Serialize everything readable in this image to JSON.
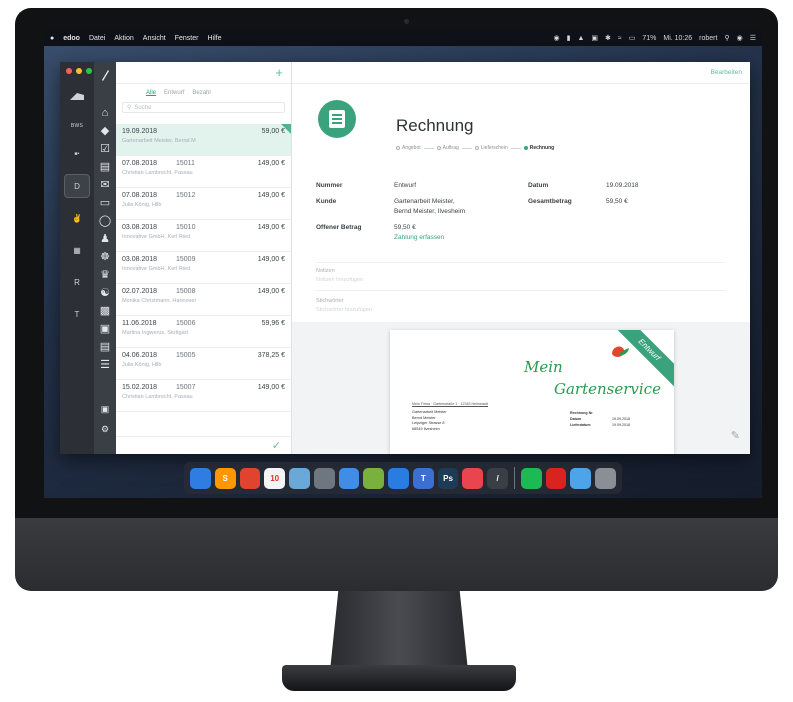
{
  "menubar": {
    "apple": "",
    "app_name": "edoo",
    "items": [
      "Datei",
      "Aktion",
      "Ansicht",
      "Fenster",
      "Hilfe"
    ],
    "clock": "Mi. 10:26",
    "user": "robert",
    "battery": "71%",
    "status_icons": [
      "wifi-icon",
      "bluetooth-icon",
      "battery-icon",
      "search-icon",
      "siri-icon",
      "notification-icon"
    ]
  },
  "workspaces": [
    "",
    "BWS",
    "",
    "D",
    "",
    "",
    "R",
    "T"
  ],
  "nav_icons": [
    "home-icon",
    "tag-icon",
    "check-icon",
    "document-icon",
    "mail-icon",
    "card-icon",
    "ring-icon",
    "person-icon",
    "group-icon",
    "hand-icon",
    "bank-icon",
    "book-icon",
    "chat-icon",
    "table-icon",
    "list-icon",
    "lock-icon",
    "gear-icon"
  ],
  "list": {
    "add": "+",
    "filters": [
      "Alle",
      "Entwurf",
      "Bezahl"
    ],
    "search_placeholder": "Suche",
    "items": [
      {
        "date": "19.09.2018",
        "number": "",
        "amount": "59,00 €",
        "customer": "Gartenarbeit Meister, Bernd M"
      },
      {
        "date": "07.08.2018",
        "number": "15011",
        "amount": "149,00 €",
        "customer": "Christian Lambrecht, Passau"
      },
      {
        "date": "07.08.2018",
        "number": "15012",
        "amount": "149,00 €",
        "customer": "Julia König, Hilb"
      },
      {
        "date": "03.08.2018",
        "number": "15010",
        "amount": "149,00 €",
        "customer": "Innovative GmbH, Kerl Ried"
      },
      {
        "date": "03.08.2018",
        "number": "15009",
        "amount": "149,00 €",
        "customer": "Innovative GmbH, Kerl Ried"
      },
      {
        "date": "02.07.2018",
        "number": "15008",
        "amount": "149,00 €",
        "customer": "Monika Christmann, Hannover"
      },
      {
        "date": "11.06.2018",
        "number": "15006",
        "amount": "59,96 €",
        "customer": "Martina Ingwerus, Stuttgart"
      },
      {
        "date": "04.06.2018",
        "number": "15005",
        "amount": "378,25 €",
        "customer": "Julia König, Hilb"
      },
      {
        "date": "15.02.2018",
        "number": "15007",
        "amount": "149,00 €",
        "customer": "Christian Lambrecht, Passau"
      }
    ]
  },
  "detail": {
    "edit": "Bearbeiten",
    "title": "Rechnung",
    "steps": [
      "Angebot",
      "Auftrag",
      "Lieferschein",
      "Rechnung"
    ],
    "fields": {
      "nummer_label": "Nummer",
      "nummer_value": "Entwurf",
      "datum_label": "Datum",
      "datum_value": "19.09.2018",
      "kunde_label": "Kunde",
      "kunde_value_1": "Gartenarbeit Meister,",
      "kunde_value_2": "Bernd Meister, Ilvesheim",
      "gesamt_label": "Gesamtbetrag",
      "gesamt_value": "59,50 €",
      "offen_label": "Offener Betrag",
      "offen_value": "59,50 €",
      "zahlung_link": "Zahlung erfassen"
    },
    "notes": {
      "label_1": "Notizen",
      "hint_1": "Notizen hinzufügen",
      "label_2": "Stichwörter",
      "hint_2": "Stichwörter hinzufügen"
    }
  },
  "preview": {
    "logo_line1": "Mein",
    "logo_line2": "Gartenservice",
    "banner": "Entwurf",
    "sender": "Mein Firma · Gartenstraße 1 · 12345 Heimstadt",
    "address": [
      "Gartenarbeit Meister",
      "Bernd Meister",
      "Leipziger Strasse 8",
      "68549 Ilvesheim"
    ],
    "meta": [
      {
        "k": "Rechnung Nr.",
        "v": ""
      },
      {
        "k": "Datum",
        "v": "19.09.2018"
      },
      {
        "k": "Lieferdatum",
        "v": "19.09.2018"
      }
    ]
  },
  "dock": {
    "apps": [
      {
        "name": "finder-icon",
        "color": "#2f7de1",
        "glyph": ""
      },
      {
        "name": "sublime-icon",
        "color": "#ff9800",
        "glyph": "S"
      },
      {
        "name": "chrome-icon",
        "color": "#e0442f",
        "glyph": ""
      },
      {
        "name": "calendar-icon",
        "color": "#f4f4f4",
        "glyph": "10"
      },
      {
        "name": "preview-icon",
        "color": "#6aa8d8",
        "glyph": ""
      },
      {
        "name": "screenshot-icon",
        "color": "#6e7680",
        "glyph": ""
      },
      {
        "name": "safari-icon",
        "color": "#3f8de6",
        "glyph": ""
      },
      {
        "name": "android-icon",
        "color": "#7ab13e",
        "glyph": ""
      },
      {
        "name": "keynote-icon",
        "color": "#2a7de0",
        "glyph": ""
      },
      {
        "name": "lamp-icon",
        "color": "#3b6fd1",
        "glyph": "T"
      },
      {
        "name": "photoshop-icon",
        "color": "#1d3b55",
        "glyph": "Ps"
      },
      {
        "name": "pocket-icon",
        "color": "#e8454e",
        "glyph": ""
      },
      {
        "name": "edoo-icon",
        "color": "#3a3e45",
        "glyph": "/"
      },
      {
        "name": "spotify-icon",
        "color": "#1db954",
        "glyph": ""
      },
      {
        "name": "acrobat-icon",
        "color": "#d8231f",
        "glyph": ""
      },
      {
        "name": "folder-icon",
        "color": "#4ea4e8",
        "glyph": ""
      },
      {
        "name": "trash-icon",
        "color": "#8a8f96",
        "glyph": ""
      }
    ]
  }
}
